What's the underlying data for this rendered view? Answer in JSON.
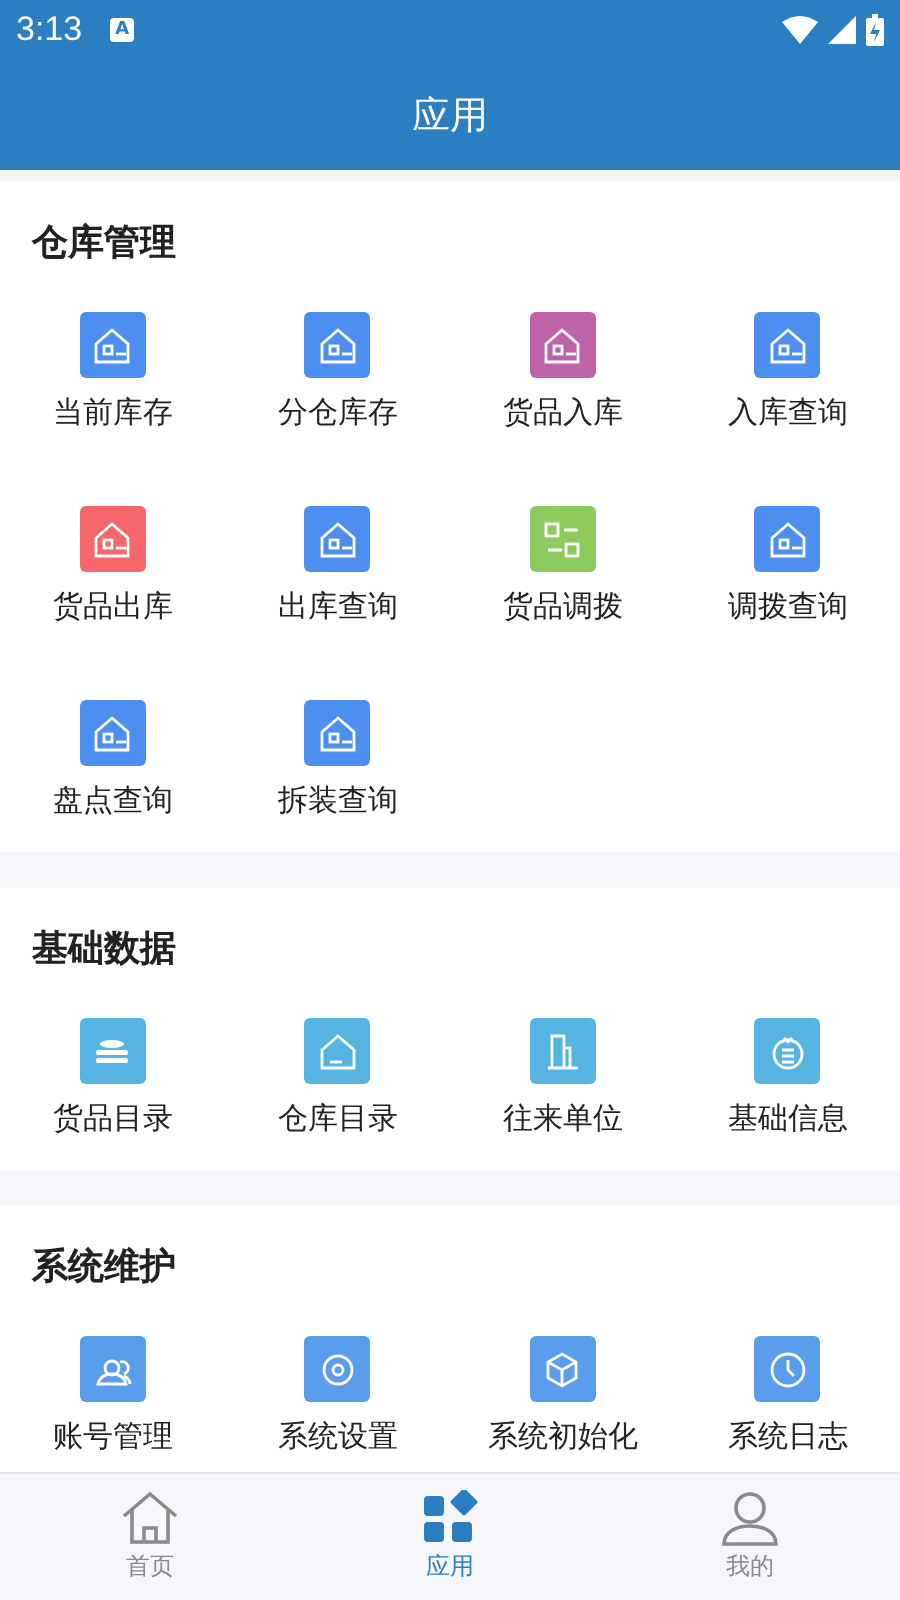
{
  "status_bar": {
    "time": "3:13",
    "notification": "A"
  },
  "header": {
    "title": "应用"
  },
  "sections": [
    {
      "title": "仓库管理",
      "items": [
        {
          "label": "当前库存",
          "color": "#4d8ff0"
        },
        {
          "label": "分仓库存",
          "color": "#4d8ff0"
        },
        {
          "label": "货品入库",
          "color": "#bf63a8"
        },
        {
          "label": "入库查询",
          "color": "#4d8ff0"
        },
        {
          "label": "货品出库",
          "color": "#f5676a"
        },
        {
          "label": "出库查询",
          "color": "#4d8ff0"
        },
        {
          "label": "货品调拨",
          "color": "#8cca5e"
        },
        {
          "label": "调拨查询",
          "color": "#4d8ff0"
        },
        {
          "label": "盘点查询",
          "color": "#4d8ff0"
        },
        {
          "label": "拆装查询",
          "color": "#4d8ff0"
        }
      ]
    },
    {
      "title": "基础数据",
      "items": [
        {
          "label": "货品目录",
          "color": "#56b4e2"
        },
        {
          "label": "仓库目录",
          "color": "#56b4e2"
        },
        {
          "label": "往来单位",
          "color": "#56b4e2"
        },
        {
          "label": "基础信息",
          "color": "#56b4e2"
        }
      ]
    },
    {
      "title": "系统维护",
      "items": [
        {
          "label": "账号管理",
          "color": "#5b9ded"
        },
        {
          "label": "系统设置",
          "color": "#5b9ded"
        },
        {
          "label": "系统初始化",
          "color": "#5b9ded"
        },
        {
          "label": "系统日志",
          "color": "#5b9ded"
        }
      ]
    }
  ],
  "bottom_nav": [
    {
      "label": "首页",
      "selected": false
    },
    {
      "label": "应用",
      "selected": true
    },
    {
      "label": "我的",
      "selected": false
    }
  ]
}
